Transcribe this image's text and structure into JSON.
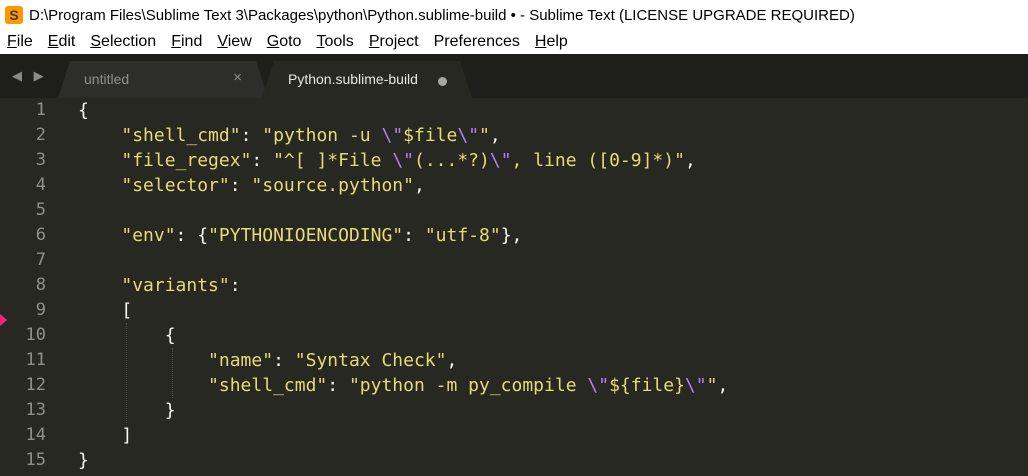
{
  "window": {
    "title": "D:\\Program Files\\Sublime Text 3\\Packages\\python\\Python.sublime-build • - Sublime Text (LICENSE UPGRADE REQUIRED)",
    "app_icon_letter": "S"
  },
  "menu": {
    "items": [
      {
        "accel": "F",
        "rest": "ile"
      },
      {
        "accel": "E",
        "rest": "dit"
      },
      {
        "accel": "S",
        "rest": "election"
      },
      {
        "accel": "F",
        "rest": "ind",
        "pre": ""
      },
      {
        "accel": "V",
        "rest": "iew"
      },
      {
        "accel": "G",
        "rest": "oto"
      },
      {
        "accel": "T",
        "rest": "ools"
      },
      {
        "accel": "P",
        "rest": "roject"
      },
      {
        "accel": "",
        "rest": "Preferences"
      },
      {
        "accel": "H",
        "rest": "elp"
      }
    ]
  },
  "tabs": {
    "nav_arrows": "◀ ▶",
    "inactive": {
      "label": "untitled",
      "close": "×"
    },
    "active": {
      "label": "Python.sublime-build"
    }
  },
  "editor": {
    "line_numbers": [
      "1",
      "2",
      "3",
      "4",
      "5",
      "6",
      "7",
      "8",
      "9",
      "10",
      "11",
      "12",
      "13",
      "14",
      "15"
    ],
    "colors": {
      "background": "#272822",
      "string": "#e6db74",
      "escape": "#ae81ff",
      "punctuation": "#f8f8f2",
      "gutter": "#8f908a"
    },
    "lines": [
      [
        {
          "t": "{",
          "c": "pun"
        }
      ],
      [
        {
          "t": "    ",
          "c": "pun"
        },
        {
          "t": "\"shell_cmd\"",
          "c": "str"
        },
        {
          "t": ": ",
          "c": "pun"
        },
        {
          "t": "\"python -u ",
          "c": "str"
        },
        {
          "t": "\\\"",
          "c": "esc"
        },
        {
          "t": "$file",
          "c": "str"
        },
        {
          "t": "\\\"",
          "c": "esc"
        },
        {
          "t": "\"",
          "c": "str"
        },
        {
          "t": ",",
          "c": "pun"
        }
      ],
      [
        {
          "t": "    ",
          "c": "pun"
        },
        {
          "t": "\"file_regex\"",
          "c": "str"
        },
        {
          "t": ": ",
          "c": "pun"
        },
        {
          "t": "\"^[ ]*File ",
          "c": "str"
        },
        {
          "t": "\\\"",
          "c": "esc"
        },
        {
          "t": "(...*?)",
          "c": "str"
        },
        {
          "t": "\\\"",
          "c": "esc"
        },
        {
          "t": ", line ([0-9]*)\"",
          "c": "str"
        },
        {
          "t": ",",
          "c": "pun"
        }
      ],
      [
        {
          "t": "    ",
          "c": "pun"
        },
        {
          "t": "\"selector\"",
          "c": "str"
        },
        {
          "t": ": ",
          "c": "pun"
        },
        {
          "t": "\"source.python\"",
          "c": "str"
        },
        {
          "t": ",",
          "c": "pun"
        }
      ],
      [],
      [
        {
          "t": "    ",
          "c": "pun"
        },
        {
          "t": "\"env\"",
          "c": "str"
        },
        {
          "t": ": {",
          "c": "pun"
        },
        {
          "t": "\"PYTHONIOENCODING\"",
          "c": "str"
        },
        {
          "t": ": ",
          "c": "pun"
        },
        {
          "t": "\"utf-8\"",
          "c": "str"
        },
        {
          "t": "},",
          "c": "pun"
        }
      ],
      [],
      [
        {
          "t": "    ",
          "c": "pun"
        },
        {
          "t": "\"variants\"",
          "c": "str"
        },
        {
          "t": ":",
          "c": "pun"
        }
      ],
      [
        {
          "t": "    [",
          "c": "pun"
        }
      ],
      [
        {
          "t": "        {",
          "c": "pun"
        }
      ],
      [
        {
          "t": "            ",
          "c": "pun"
        },
        {
          "t": "\"name\"",
          "c": "str"
        },
        {
          "t": ": ",
          "c": "pun"
        },
        {
          "t": "\"Syntax Check\"",
          "c": "str"
        },
        {
          "t": ",",
          "c": "pun"
        }
      ],
      [
        {
          "t": "            ",
          "c": "pun"
        },
        {
          "t": "\"shell_cmd\"",
          "c": "str"
        },
        {
          "t": ": ",
          "c": "pun"
        },
        {
          "t": "\"python -m py_compile ",
          "c": "str"
        },
        {
          "t": "\\\"",
          "c": "esc"
        },
        {
          "t": "${file}",
          "c": "str"
        },
        {
          "t": "\\\"",
          "c": "esc"
        },
        {
          "t": "\"",
          "c": "str"
        },
        {
          "t": ",",
          "c": "pun"
        }
      ],
      [
        {
          "t": "        }",
          "c": "pun"
        }
      ],
      [
        {
          "t": "    ]",
          "c": "pun"
        }
      ],
      [
        {
          "t": "}",
          "c": "pun"
        }
      ]
    ]
  }
}
